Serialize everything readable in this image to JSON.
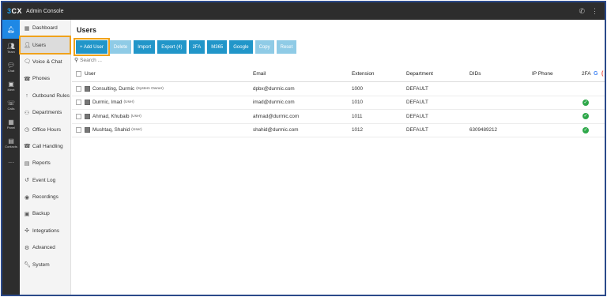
{
  "topbar": {
    "logo_main": "3CX",
    "app_title": "Admin Console",
    "right_icons": [
      "phone-icon",
      "menu-icon"
    ]
  },
  "rail": [
    {
      "label": "",
      "icon": "bell-icon"
    },
    {
      "label": "Team",
      "icon": "team-icon"
    },
    {
      "label": "Chat",
      "icon": "chat-icon"
    },
    {
      "label": "Meet",
      "icon": "meet-icon"
    },
    {
      "label": "Calls",
      "icon": "calls-icon"
    },
    {
      "label": "Panel",
      "icon": "panel-icon"
    },
    {
      "label": "Contacts",
      "icon": "contacts-icon"
    },
    {
      "label": "",
      "icon": "more-icon"
    }
  ],
  "sidebar": {
    "items": [
      {
        "label": "Dashboard",
        "icon": "dashboard-icon"
      },
      {
        "label": "Users",
        "icon": "user-icon"
      },
      {
        "label": "Voice & Chat",
        "icon": "voice-chat-icon"
      },
      {
        "label": "Phones",
        "icon": "phones-icon"
      },
      {
        "label": "Outbound Rules",
        "icon": "outbound-icon"
      },
      {
        "label": "Departments",
        "icon": "departments-icon"
      },
      {
        "label": "Office Hours",
        "icon": "clock-icon"
      },
      {
        "label": "Call Handling",
        "icon": "call-handling-icon"
      },
      {
        "label": "Reports",
        "icon": "reports-icon"
      },
      {
        "label": "Event Log",
        "icon": "event-log-icon"
      },
      {
        "label": "Recordings",
        "icon": "recordings-icon"
      },
      {
        "label": "Backup",
        "icon": "backup-icon"
      },
      {
        "label": "Integrations",
        "icon": "integrations-icon"
      },
      {
        "label": "Advanced",
        "icon": "gear-icon"
      },
      {
        "label": "System",
        "icon": "wrench-icon"
      }
    ]
  },
  "main": {
    "title": "Users",
    "toolbar": {
      "add_user": "+ Add User",
      "delete": "Delete",
      "import": "Import",
      "export": "Export (4)",
      "twofa": "2FA",
      "m365": "M365",
      "google": "Google",
      "copy": "Copy",
      "reset": "Reset"
    },
    "search": {
      "placeholder": "Search ..."
    },
    "table": {
      "headers": {
        "user": "User",
        "email": "Email",
        "extension": "Extension",
        "department": "Department",
        "dids": "DIDs",
        "ip_phone": "IP Phone",
        "twofa": "2FA"
      },
      "rows": [
        {
          "name": "Consulting, Durmic",
          "role": "(System Owner)",
          "email": "dpbx@durmic.com",
          "extension": "1000",
          "department": "DEFAULT",
          "dids": "",
          "ip_phone": "",
          "twofa": ""
        },
        {
          "name": "Durmic, Imad",
          "role": "(User)",
          "email": "imad@durmic.com",
          "extension": "1010",
          "department": "DEFAULT",
          "dids": "",
          "ip_phone": "",
          "twofa": "enabled"
        },
        {
          "name": "Ahmad, Khubaib",
          "role": "(User)",
          "email": "ahmad@durmic.com",
          "extension": "1011",
          "department": "DEFAULT",
          "dids": "",
          "ip_phone": "",
          "twofa": "enabled"
        },
        {
          "name": "Mushtaq, Shahid",
          "role": "(User)",
          "email": "shahid@durmic.com",
          "extension": "1012",
          "department": "DEFAULT",
          "dids": "6309489212",
          "ip_phone": "",
          "twofa": "enabled"
        }
      ]
    }
  },
  "colors": {
    "accent": "#2196c9",
    "highlight": "#f0a21b",
    "topbar": "#2d2d2d",
    "success": "#2ea84a"
  }
}
